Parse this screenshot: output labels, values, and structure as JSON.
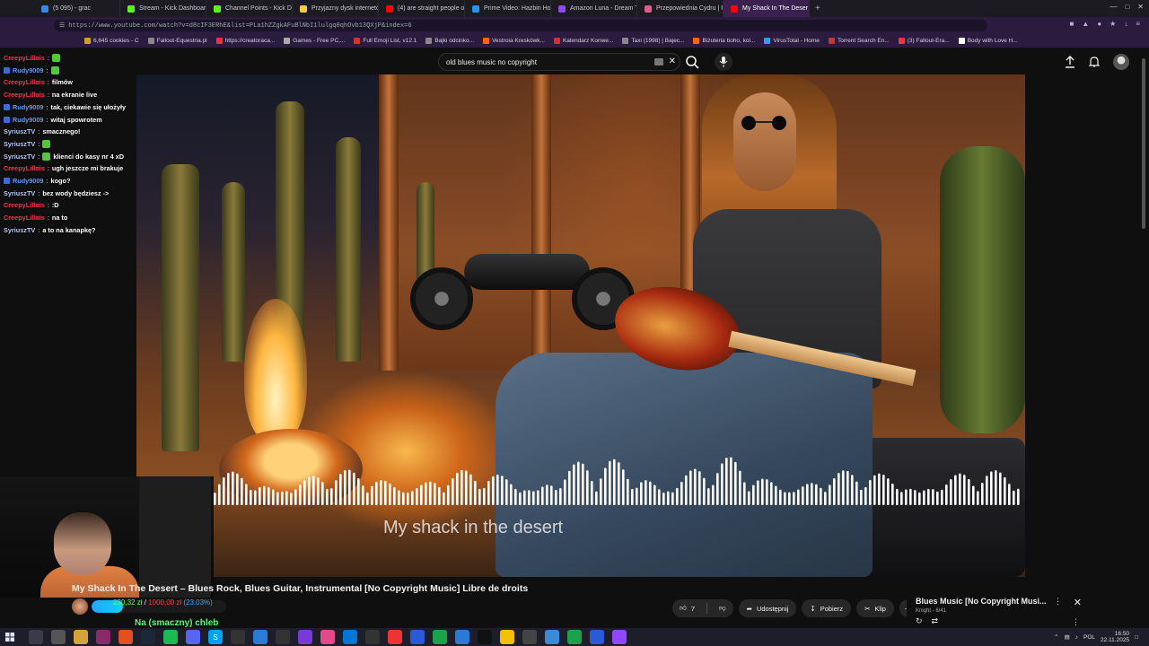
{
  "browser": {
    "tabs": [
      {
        "label": "(5 095) - grac",
        "color": "#3b82f6"
      },
      {
        "label": "Stream - Kick Dashboard",
        "color": "#53fc18"
      },
      {
        "label": "Channel Points - Kick Da",
        "color": "#53fc18"
      },
      {
        "label": "Przyjazny dysk internetowy",
        "color": "#f4d03f"
      },
      {
        "label": "(4) are straight people o",
        "color": "#ff0000"
      },
      {
        "label": "Prime Video: Hazbin Hote",
        "color": "#1a98ff"
      },
      {
        "label": "Amazon Luna - Dream Ta",
        "color": "#9146ff"
      },
      {
        "label": "Przepowiednia Cydru | R",
        "color": "#e05a8a"
      },
      {
        "label": "My Shack In The Deser",
        "color": "#ff0000",
        "active": true
      }
    ],
    "new_tab": "+",
    "url": "https://www.youtube.com/watch?v=d8cIF3ERhE&list=PLa1hZZgkAFuBlNbI1lulgq0qhOvb13QXjP&index=6",
    "bookmarks": [
      {
        "label": "6,645 cookies - C",
        "color": "#c9a227"
      },
      {
        "label": "Fallout-Equestria.pl",
        "color": "#888888"
      },
      {
        "label": "https://creatoraca...",
        "color": "#e33"
      },
      {
        "label": "Games - Free PC,...",
        "color": "#aaa"
      },
      {
        "label": "Full Emoji List, v12.1",
        "color": "#c33"
      },
      {
        "label": "Bajki odcinko...",
        "color": "#888"
      },
      {
        "label": "Vestroia Kreskówk...",
        "color": "#f60"
      },
      {
        "label": "Kalendarz Konwe...",
        "color": "#c33"
      },
      {
        "label": "Taxi (1998) | Bajec...",
        "color": "#888"
      },
      {
        "label": "Biżuteria boho, kol...",
        "color": "#f60"
      },
      {
        "label": "VirusTotal - Home",
        "color": "#39f"
      },
      {
        "label": "Torrent Search En...",
        "color": "#c33"
      },
      {
        "label": "(3) Fallout-Era...",
        "color": "#f33"
      },
      {
        "label": "Body with Love H...",
        "color": "#fff"
      }
    ]
  },
  "youtube": {
    "search": {
      "value": "old blues music no copyright"
    },
    "video": {
      "caption": "My shack in the desert",
      "title": "My Shack In The Desert – Blues Rock, Blues Guitar, Instrumental [No Copyright Music] Libre de droits"
    },
    "actions": {
      "likes": "7",
      "share": "Udostępnij",
      "download": "Pobierz",
      "clip": "Klip"
    },
    "playlist": {
      "title": "Blues Music [No Copyright Musi...",
      "meta": "Knight - 6/41"
    }
  },
  "stream": {
    "chat": [
      {
        "user": "CreepyLillois",
        "text": "",
        "color": "#ff3355",
        "badge": false,
        "emote": true
      },
      {
        "user": "Rudy9009",
        "text": "",
        "color": "#5aa0ff",
        "badge": true,
        "emote": true
      },
      {
        "user": "CreepyLillois",
        "text": "filmów",
        "color": "#ff3355",
        "badge": false
      },
      {
        "user": "CreepyLillois",
        "text": "na ekranie live",
        "color": "#ff3355",
        "badge": false
      },
      {
        "user": "Rudy9009",
        "text": "tak, ciekawie się ułożyły",
        "color": "#5aa0ff",
        "badge": true
      },
      {
        "user": "Rudy9009",
        "text": "witaj spowrotem",
        "color": "#5aa0ff",
        "badge": true
      },
      {
        "user": "SyriuszTV",
        "text": "smacznego!",
        "color": "#b6c9ff",
        "badge": false
      },
      {
        "user": "SyriuszTV",
        "text": "",
        "color": "#b6c9ff",
        "badge": false,
        "emote": true
      },
      {
        "user": "SyriuszTV",
        "text": "klienci do kasy nr 4 xD",
        "color": "#b6c9ff",
        "badge": false,
        "emote": true
      },
      {
        "user": "CreepyLillois",
        "text": "ugh jeszcze mi brakuje",
        "color": "#ff3355",
        "badge": false
      },
      {
        "user": "Rudy9009",
        "text": "kogo?",
        "color": "#5aa0ff",
        "badge": true
      },
      {
        "user": "SyriuszTV",
        "text": "bez wody będziesz ->",
        "color": "#b6c9ff",
        "badge": false
      },
      {
        "user": "CreepyLillois",
        "text": ":D",
        "color": "#ff3355",
        "badge": false
      },
      {
        "user": "CreepyLillois",
        "text": "na to",
        "color": "#ff3355",
        "badge": false
      },
      {
        "user": "SyriuszTV",
        "text": "a to na kanapkę?",
        "color": "#b6c9ff",
        "badge": false
      }
    ],
    "donation": {
      "current": "230,32 zł",
      "separator": "/",
      "goal": "1000,00 zł",
      "percent_text": "(23.03%)",
      "progress": 0.2303
    },
    "overlay_message": "Na (smaczny) chleb"
  },
  "taskbar": {
    "lang": "POL",
    "time": "16:50",
    "date": "22.11.2025",
    "apps": [
      {
        "label": "",
        "color": "#3a3a4a"
      },
      {
        "label": "",
        "color": "#555"
      },
      {
        "label": "",
        "color": "#d6a23a"
      },
      {
        "label": "",
        "color": "#8a2a6a"
      },
      {
        "label": "",
        "color": "#e05020"
      },
      {
        "label": "",
        "color": "#1b2838"
      },
      {
        "label": "",
        "color": "#1db954"
      },
      {
        "label": "",
        "color": "#5865f2"
      },
      {
        "label": "S",
        "color": "#00a2ed"
      },
      {
        "label": "",
        "color": "#333"
      },
      {
        "label": "",
        "color": "#2a7ad8"
      },
      {
        "label": "",
        "color": "#333"
      },
      {
        "label": "",
        "color": "#7a3ad8"
      },
      {
        "label": "",
        "color": "#e24a8a"
      },
      {
        "label": "",
        "color": "#0078d4"
      },
      {
        "label": "",
        "color": "#333"
      },
      {
        "label": "",
        "color": "#e33"
      },
      {
        "label": "",
        "color": "#2a5ad8"
      },
      {
        "label": "",
        "color": "#1aa34a"
      },
      {
        "label": "",
        "color": "#2a7ad8"
      },
      {
        "label": "",
        "color": "#111"
      },
      {
        "label": "",
        "color": "#f5c000"
      },
      {
        "label": "",
        "color": "#444"
      },
      {
        "label": "",
        "color": "#3a8ad8"
      },
      {
        "label": "",
        "color": "#1aa34a"
      },
      {
        "label": "",
        "color": "#2a5ad8"
      },
      {
        "label": "",
        "color": "#9146ff"
      }
    ]
  }
}
